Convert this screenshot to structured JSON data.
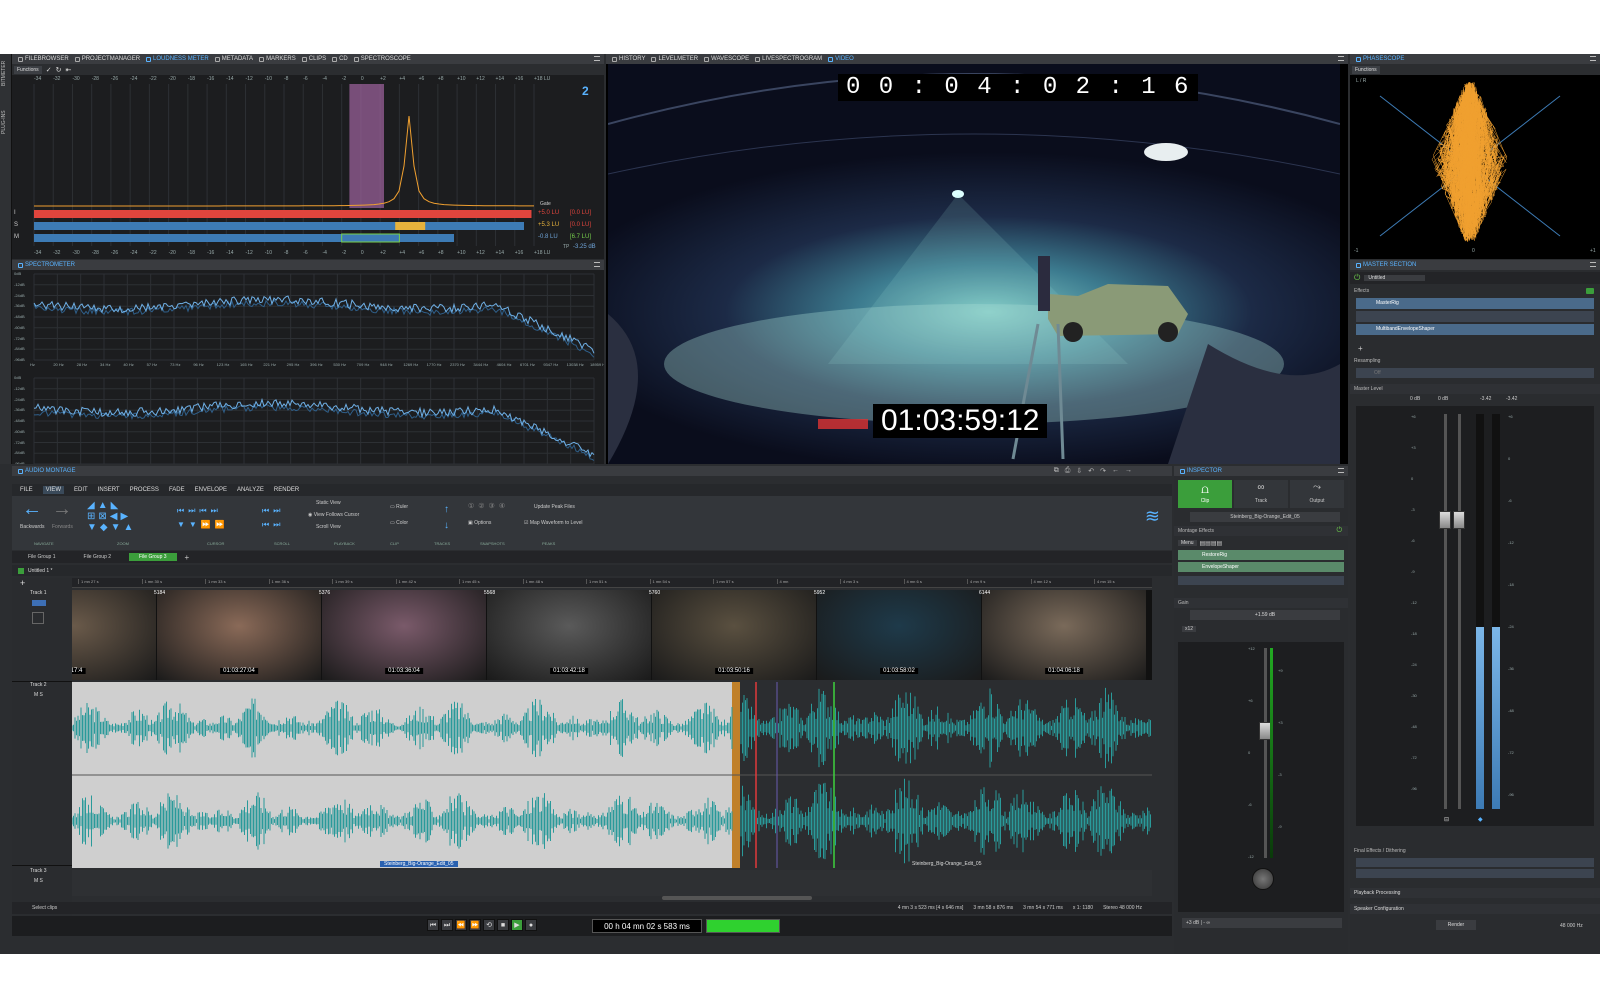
{
  "leftTabs": [
    "FILEBROWSER",
    "PROJECTMANAGER",
    "LOUDNESS METER",
    "METADATA",
    "MARKERS",
    "CLIPS",
    "CD",
    "SPECTROSCOPE"
  ],
  "leftTabSelected": 2,
  "sideTabs": [
    "BITMETER",
    "PLUG-INS"
  ],
  "loudness": {
    "functions": "Functions",
    "scale": [
      "-34",
      "-32",
      "-30",
      "-28",
      "-26",
      "-24",
      "-22",
      "-20",
      "-18",
      "-16",
      "-14",
      "-12",
      "-10",
      "-8",
      "-6",
      "-4",
      "-2",
      "0",
      "+2",
      "+4",
      "+6",
      "+8",
      "+10",
      "+12",
      "+14",
      "+16",
      "+18 LU"
    ],
    "rows": [
      {
        "label": "I",
        "value": "+5.0 LU",
        "max": "[0.0 LU]",
        "vcolor": "#e0453d",
        "mcolor": "#e0453d"
      },
      {
        "label": "S",
        "value": "+5.3 LU",
        "max": "[0.0 LU]",
        "vcolor": "#e6b23c",
        "mcolor": "#e0453d"
      },
      {
        "label": "M",
        "value": "-0.8 LU",
        "max": "[6.7 LU]",
        "vcolor": "#6fa4d8",
        "mcolor": "#77d04c"
      }
    ],
    "gate": "Gate",
    "tp": "TP",
    "tpValue": "-3.25 dB",
    "levelI": 0.995,
    "levelS": 0.98,
    "levelM": 0.84
  },
  "spectrometer": {
    "title": "SPECTROMETER",
    "dbLabels": [
      "0dB",
      "-12dB",
      "-24dB",
      "-36dB",
      "-48dB",
      "-60dB",
      "-72dB",
      "-84dB",
      "-96dB"
    ],
    "hzLabels": [
      "Hz",
      "20 Hz",
      "28 Hz",
      "34 Hz",
      "40 Hz",
      "57 Hz",
      "73 Hz",
      "96 Hz",
      "123 Hz",
      "165 Hz",
      "221 Hz",
      "295 Hz",
      "396 Hz",
      "530 Hz",
      "709 Hz",
      "948 Hz",
      "1269 Hz",
      "1770 Hz",
      "2370 Hz",
      "3444 Hz",
      "4604 Hz",
      "6701 Hz",
      "9347 Hz",
      "13038 Hz",
      "18959 Hz"
    ]
  },
  "centerTabs": [
    "HISTORY",
    "LEVELMETER",
    "WAVESCOPE",
    "LIVESPECTROGRAM",
    "VIDEO"
  ],
  "centerTabSelected": 4,
  "video": {
    "timecodeTop": "0 0 : 0 4 : 0 2 : 1 6",
    "timecodeBottom": "01:03:59:12"
  },
  "phase": {
    "title": "PHASESCOPE",
    "functions": "Functions",
    "topLabel": "L / R",
    "axis": [
      "-1",
      "0",
      "+1"
    ]
  },
  "master": {
    "title": "MASTER SECTION",
    "preset": "Untitled",
    "effects": "Effects",
    "plugins": [
      "MasterRig",
      "",
      "MultibandEnvelopeShaper"
    ],
    "resampling": "Resampling",
    "resampOff": "Off",
    "masterLevel": "Master Level",
    "peak": [
      "0 dB",
      "0 dB",
      "-3.42",
      "-3.42"
    ],
    "scale": [
      "+6",
      "+3",
      "0",
      "-3",
      "-6",
      "-9",
      "-12",
      "-18",
      "-24",
      "-30",
      "-48",
      "-72",
      "-96"
    ],
    "rightScale": [
      "+6",
      "0",
      "-6",
      "-12",
      "-18",
      "-24",
      "-36",
      "-48",
      "-72",
      "-96"
    ],
    "finalEffects": "Final Effects / Dithering",
    "playback": "Playback Processing",
    "speaker": "Speaker Configuration",
    "render": "Render",
    "sampleRate": "48 000 Hz"
  },
  "montage": {
    "title": "AUDIO MONTAGE",
    "menu": [
      "FILE",
      "VIEW",
      "EDIT",
      "INSERT",
      "PROCESS",
      "FADE",
      "ENVELOPE",
      "ANALYZE",
      "RENDER"
    ],
    "menuSelected": 1,
    "ribbon": {
      "backwards": "Backwards",
      "forwards": "Forwards",
      "staticView": "Static View",
      "viewFollows": "View Follows Cursor",
      "scrollView": "Scroll View",
      "ruler": "Ruler",
      "color": "Color",
      "options": "Options",
      "updatePeak": "Update Peak Files",
      "mapWaveform": "Map Waveform to Level"
    },
    "groups": [
      "NAVIGATE",
      "ZOOM",
      "CURSOR",
      "SCROLL",
      "PLAYBACK",
      "CLIP",
      "TRACKS",
      "SNAPSHOTS",
      "PEAKS"
    ],
    "fileGroups": [
      "File Group 1",
      "File Group 2",
      "File Group 3"
    ],
    "fileGroupSelected": 2,
    "untitled": "Untitled 1 *",
    "ruler": [
      "1 mn 27 s",
      "1 mn 30 s",
      "1 mn 33 s",
      "1 mn 36 s",
      "1 mn 39 s",
      "1 mn 42 s",
      "1 mn 45 s",
      "1 mn 48 s",
      "1 mn 51 s",
      "1 mn 54 s",
      "1 mn 57 s",
      "4 mn",
      "4 mn 3 s",
      "4 mn 6 s",
      "4 mn 9 s",
      "4 mn 12 s",
      "4 mn 15 s"
    ],
    "tracks": [
      "Track 1",
      "Track 2",
      "Track 3"
    ],
    "frameNumbers": [
      "5184",
      "5376",
      "5568",
      "5760",
      "5952",
      "6144"
    ],
    "thumbTc": [
      "0:17:4",
      "01:03:27:04",
      "01:03:36:04",
      "01:03:42:18",
      "01:03:50:16",
      "01:03:58:02",
      "01:04:06:18"
    ],
    "clipName": "Steinberg_Big-Orange_Edit_05",
    "status": "Select clips",
    "statusRight": [
      "4 mn 3 s 523 ms [4 s 646 ms]",
      "3 mn 58 s 876 ms",
      "3 mn 54 s 771 ms",
      "x 1: 1180",
      "Stereo 48 000 Hz"
    ],
    "transportTime": "00 h 04 mn 02 s 583 ms"
  },
  "inspector": {
    "title": "INSPECTOR",
    "tabs": [
      "Clip",
      "Track",
      "Output"
    ],
    "clipName": "Steinberg_Big-Orange_Edit_05",
    "montageEffects": "Montage Effects",
    "menu": "Menu",
    "effects": [
      "RestoreRig",
      "EnvelopeShaper"
    ],
    "gain": "Gain",
    "gainValue": "+1.59 dB",
    "x12": "x12",
    "scale": [
      "+12",
      "+6",
      "0",
      "-6",
      "-12"
    ],
    "rscale": [
      "+9",
      "+3",
      "-3",
      "-9"
    ],
    "bottom": "+3 dB | - ∞"
  }
}
